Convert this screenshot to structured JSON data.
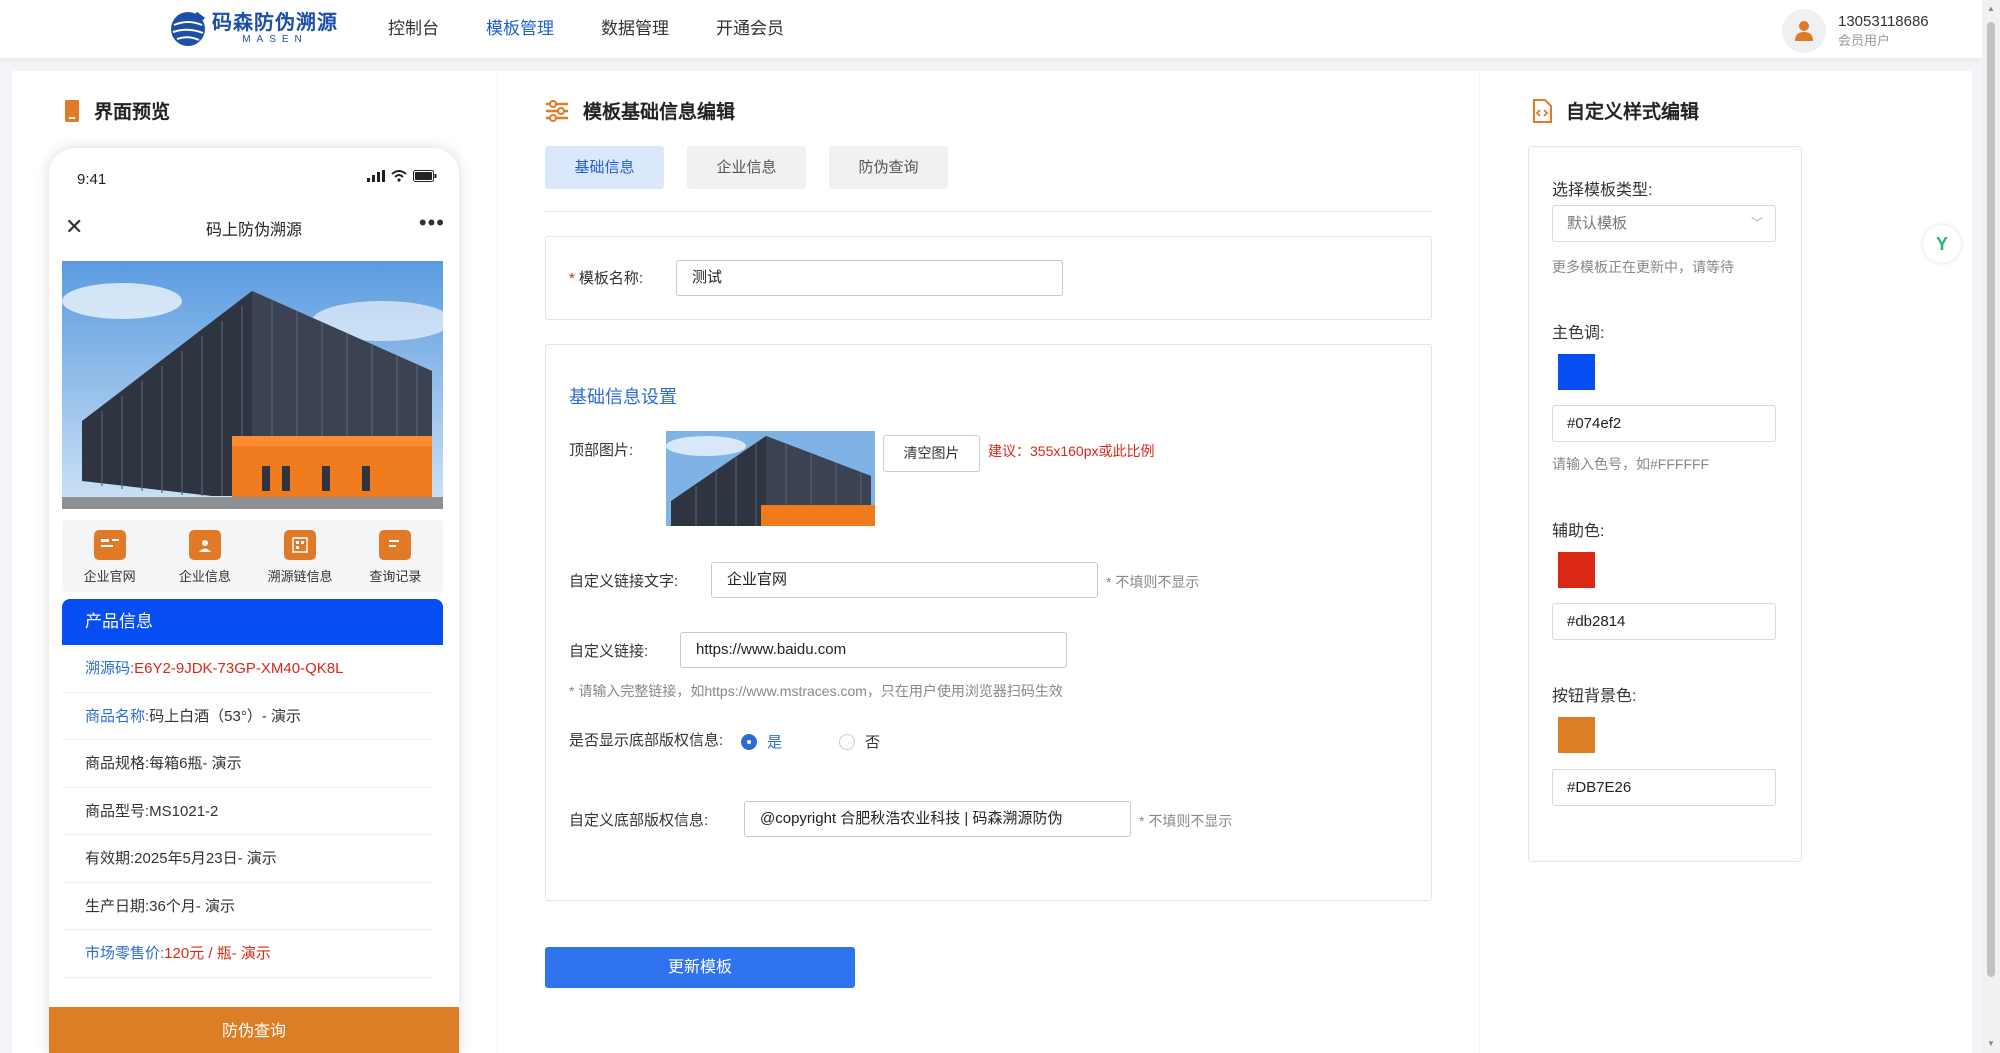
{
  "header": {
    "logo_cn": "码森防伪溯源",
    "logo_en": "MASEN",
    "nav": [
      {
        "label": "控制台"
      },
      {
        "label": "模板管理"
      },
      {
        "label": "数据管理"
      },
      {
        "label": "开通会员"
      }
    ],
    "active_nav": "模板管理",
    "user_phone": "13053118686",
    "user_role": "会员用户"
  },
  "preview": {
    "title": "界面预览",
    "status_time": "9:41",
    "mini_title": "码上防伪溯源",
    "quick_links": [
      {
        "label": "企业官网",
        "icon": "id-card-icon"
      },
      {
        "label": "企业信息",
        "icon": "folder-user-icon"
      },
      {
        "label": "溯源链信息",
        "icon": "chain-list-icon"
      },
      {
        "label": "查询记录",
        "icon": "record-doc-icon"
      }
    ],
    "product_header": "产品信息",
    "info": [
      {
        "key": "溯源码:",
        "value": "E6Y2-9JDK-73GP-XM40-QK8L"
      },
      {
        "key": "商品名称:",
        "value": "码上白酒（53°）- 演示"
      },
      {
        "key": "商品规格:",
        "value": "每箱6瓶- 演示"
      },
      {
        "key": "商品型号:",
        "value": "MS1021-2"
      },
      {
        "key": "有效期:",
        "value": "2025年5月23日- 演示"
      },
      {
        "key": "生产日期:",
        "value": "36个月- 演示"
      },
      {
        "key": "市场零售价:",
        "value": "120元 / 瓶- 演示"
      }
    ],
    "bottom_button": "防伪查询"
  },
  "editor": {
    "title": "模板基础信息编辑",
    "tabs": [
      {
        "label": "基础信息"
      },
      {
        "label": "企业信息"
      },
      {
        "label": "防伪查询"
      }
    ],
    "template_name_label": "模板名称:",
    "template_name_value": "测试",
    "section_title": "基础信息设置",
    "top_image_label": "顶部图片:",
    "clear_image_label": "清空图片",
    "image_suggest": "建议：355x160px或此比例",
    "link_text_label": "自定义链接文字:",
    "link_text_value": "企业官网",
    "link_text_hint": "* 不填则不显示",
    "link_label": "自定义链接:",
    "link_value": "https://www.baidu.com",
    "link_hint": "* 请输入完整链接，如https://www.mstraces.com，只在用户使用浏览器扫码生效",
    "show_copyright_label": "是否显示底部版权信息:",
    "radio_yes": "是",
    "radio_no": "否",
    "copyright_label": "自定义底部版权信息:",
    "copyright_value": "@copyright 合肥秋浩农业科技 | 码森溯源防伪",
    "copyright_hint": "* 不填则不显示",
    "update_button": "更新模板"
  },
  "style": {
    "title": "自定义样式编辑",
    "template_type_label": "选择模板类型:",
    "template_type_value": "默认模板",
    "template_type_hint": "更多模板正在更新中，请等待",
    "primary_label": "主色调:",
    "primary_color": "#074ef2",
    "primary_hint": "请输入色号，如#FFFFFF",
    "secondary_label": "辅助色:",
    "secondary_color": "#db2814",
    "button_bg_label": "按钮背景色:",
    "button_bg_color": "#DB7E26"
  }
}
